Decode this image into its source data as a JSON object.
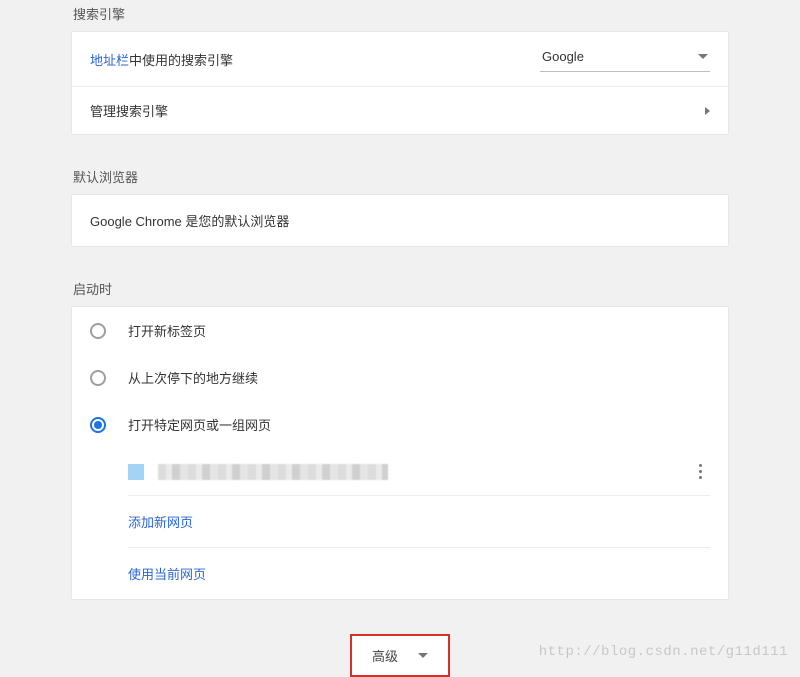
{
  "sections": {
    "searchEngine": {
      "title": "搜索引擎",
      "addressBarRow": {
        "linkText": "地址栏",
        "suffix": "中使用的搜索引擎",
        "selected": "Google"
      },
      "manageLabel": "管理搜索引擎"
    },
    "defaultBrowser": {
      "title": "默认浏览器",
      "message": "Google Chrome 是您的默认浏览器"
    },
    "onStartup": {
      "title": "启动时",
      "options": {
        "newTab": "打开新标签页",
        "continue": "从上次停下的地方继续",
        "specific": "打开特定网页或一组网页"
      },
      "selectedIndex": 2,
      "addNewPage": "添加新网页",
      "useCurrent": "使用当前网页"
    }
  },
  "advancedLabel": "高级",
  "watermark": "http://blog.csdn.net/g11d111"
}
